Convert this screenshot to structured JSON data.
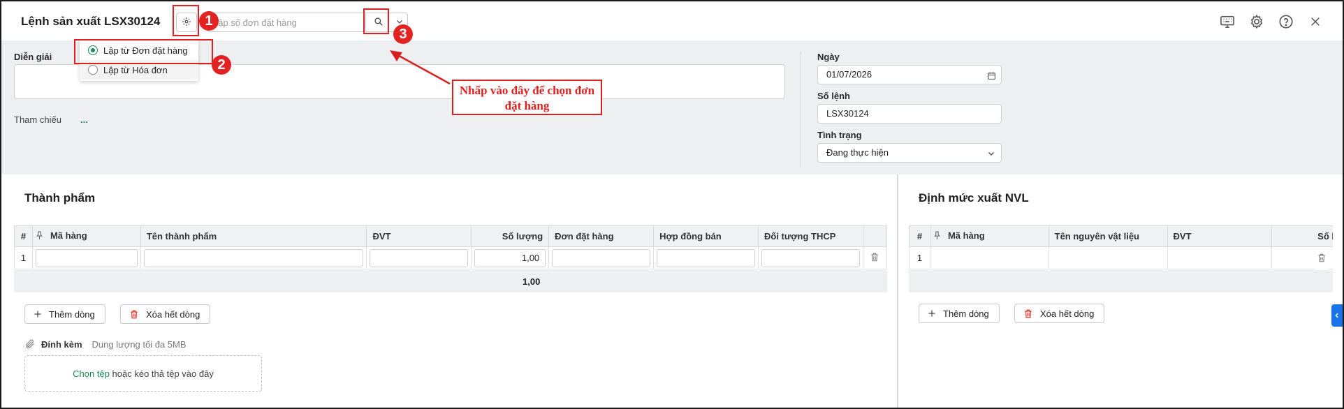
{
  "header": {
    "title": "Lệnh sản xuất LSX30124",
    "search_placeholder": "Lập số đơn đặt hàng"
  },
  "popup": {
    "items": [
      {
        "label": "Lập từ Đơn đặt hàng",
        "selected": true
      },
      {
        "label": "Lập từ Hóa đơn",
        "selected": false
      }
    ]
  },
  "form": {
    "dien_giai_label": "Diễn giải",
    "tham_chieu_label": "Tham chiếu",
    "tham_chieu_value": "...",
    "ngay_label": "Ngày",
    "ngay_value": "01/07/2026",
    "so_lenh_label": "Số lệnh",
    "so_lenh_value": "LSX30124",
    "tinh_trang_label": "Tình trạng",
    "tinh_trang_value": "Đang thực hiện"
  },
  "thanh_pham": {
    "title": "Thành phẩm",
    "columns": [
      "#",
      "Mã hàng",
      "Tên thành phẩm",
      "ĐVT",
      "Số lượng",
      "Đơn đặt hàng",
      "Hợp đồng bán",
      "Đối tượng THCP"
    ],
    "rows": [
      {
        "index": "1",
        "ma_hang": "",
        "ten": "",
        "dvt": "",
        "so_luong": "1,00",
        "don_dat_hang": "",
        "hop_dong_ban": "",
        "doi_tuong": ""
      }
    ],
    "total": "1,00",
    "add_row_label": "Thêm dòng",
    "clear_rows_label": "Xóa hết dòng"
  },
  "attachment": {
    "label": "Đính kèm",
    "hint": "Dung lượng tối đa 5MB",
    "choose_label": "Chọn tệp",
    "drop_hint": "hoặc kéo thả tệp vào đây"
  },
  "dinh_muc": {
    "title": "Định mức xuất NVL",
    "columns": [
      "#",
      "Mã hàng",
      "Tên nguyên vật liệu",
      "ĐVT",
      "Số l"
    ],
    "rows": [
      {
        "index": "1"
      }
    ],
    "add_row_label": "Thêm dòng",
    "clear_rows_label": "Xóa hết dòng"
  },
  "annotations": {
    "badge1": "1",
    "badge2": "2",
    "badge3": "3",
    "callout_text": "Nhấp vào đây để chọn đơn đặt hàng"
  },
  "colors": {
    "accent_green": "#1b8a5a",
    "annotation_red": "#e02020",
    "side_tab_blue": "#1a73e8"
  }
}
